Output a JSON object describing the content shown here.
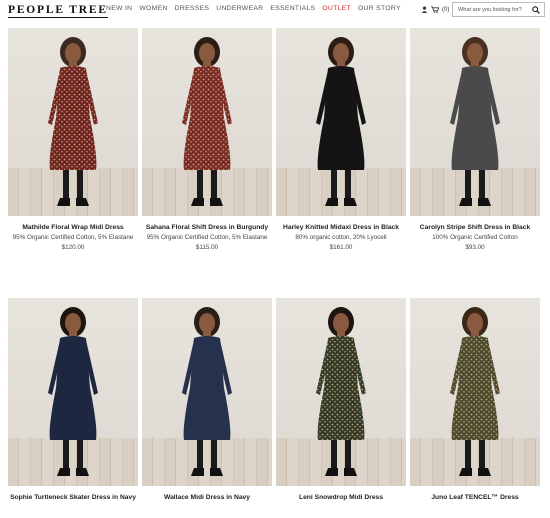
{
  "header": {
    "logo": "PEOPLE TREE",
    "nav": [
      "NEW IN",
      "WOMEN",
      "DRESSES",
      "UNDERWEAR",
      "ESSENTIALS",
      "OUTLET",
      "OUR STORY"
    ],
    "cart_count": "(0)",
    "search_placeholder": "What are you looking for?"
  },
  "products": [
    {
      "name": "Mathilde Floral Wrap Midi Dress",
      "desc": "95% Organic Certified Cotton, 5% Elastane",
      "price": "$120.00",
      "color": "#6e2422",
      "pattern": "dots",
      "hair": "#3a2a1f"
    },
    {
      "name": "Sahana Floral Shift Dress in Burgundy",
      "desc": "95% Organic Certified Cotton, 5% Elastane",
      "price": "$115.00",
      "color": "#7a2a26",
      "pattern": "dots",
      "hair": "#2b1c14"
    },
    {
      "name": "Harley Knitted Midaxi Dress in Black",
      "desc": "80% organic cotton, 20% Lyocell",
      "price": "$161.00",
      "color": "#141414",
      "pattern": "plain",
      "hair": "#2b1c14"
    },
    {
      "name": "Carolyn Stripe Shift Dress in Black",
      "desc": "100% Organic Certified Cotton",
      "price": "$93.00",
      "color": "#4a4a4a",
      "pattern": "plain",
      "hair": "#4a3020"
    },
    {
      "name": "Sophie Turtleneck Skater Dress in Navy",
      "desc": "",
      "price": "",
      "color": "#1d2840",
      "pattern": "plain",
      "hair": "#1e1510"
    },
    {
      "name": "Wallace Midi Dress in Navy",
      "desc": "",
      "price": "",
      "color": "#26324d",
      "pattern": "plain",
      "hair": "#2a1e15"
    },
    {
      "name": "Leni Snowdrop Midi Dress",
      "desc": "",
      "price": "",
      "color": "#2f3a2a",
      "pattern": "dots",
      "hair": "#1e1510"
    },
    {
      "name": "Juno Leaf TENCEL™ Dress",
      "desc": "",
      "price": "",
      "color": "#4a4a30",
      "pattern": "dots",
      "hair": "#3b2718"
    }
  ]
}
